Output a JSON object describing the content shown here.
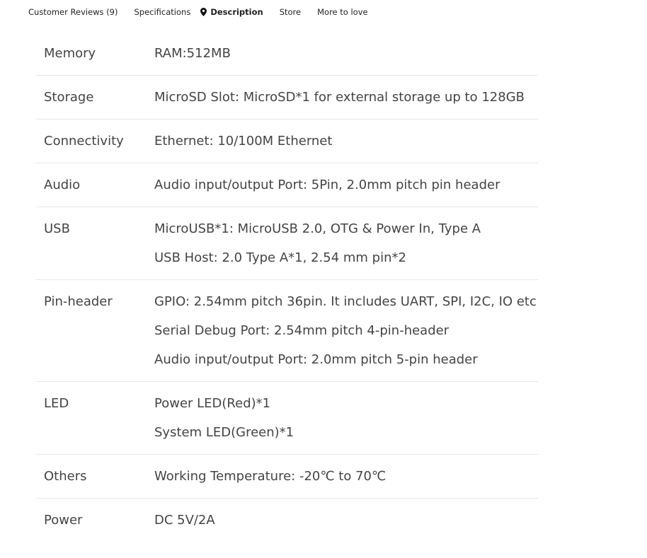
{
  "tabs": {
    "reviews": "Customer Reviews (9)",
    "specifications": "Specifications",
    "description": "Description",
    "store": "Store",
    "more": "More to love"
  },
  "specs": [
    {
      "label": "Memory",
      "values": [
        "RAM:512MB"
      ]
    },
    {
      "label": "Storage",
      "values": [
        "MicroSD Slot: MicroSD*1 for external storage up to 128GB"
      ]
    },
    {
      "label": "Connectivity",
      "values": [
        "Ethernet: 10/100M Ethernet"
      ]
    },
    {
      "label": "Audio",
      "values": [
        "Audio input/output Port: 5Pin, 2.0mm pitch pin header"
      ]
    },
    {
      "label": "USB",
      "values": [
        "MicroUSB*1: MicroUSB 2.0, OTG & Power In, Type A",
        "USB Host: 2.0 Type A*1, 2.54 mm pin*2"
      ]
    },
    {
      "label": "Pin-header",
      "values": [
        "GPIO: 2.54mm pitch 36pin. It includes UART, SPI, I2C, IO etc",
        "Serial Debug Port: 2.54mm pitch 4-pin-header",
        "Audio input/output Port: 2.0mm pitch 5-pin header"
      ]
    },
    {
      "label": "LED",
      "values": [
        "Power LED(Red)*1",
        "System LED(Green)*1"
      ]
    },
    {
      "label": "Others",
      "values": [
        "Working Temperature: -20℃ to 70℃"
      ]
    },
    {
      "label": "Power",
      "values": [
        "DC 5V/2A"
      ]
    }
  ]
}
